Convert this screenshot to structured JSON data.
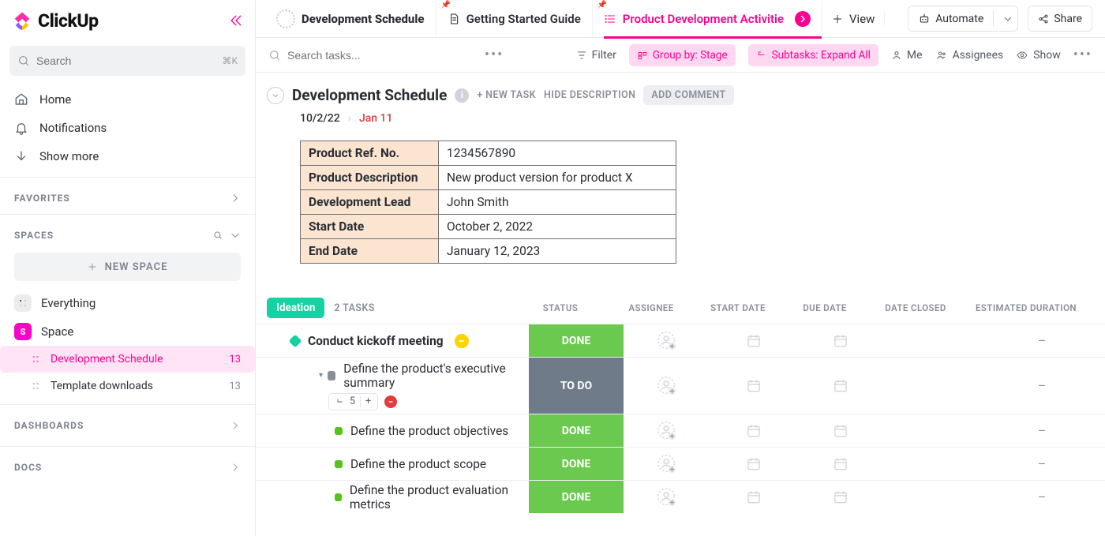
{
  "brand": {
    "name": "ClickUp"
  },
  "sidebar": {
    "search_placeholder": "Search",
    "search_kbd": "⌘K",
    "nav": [
      "Home",
      "Notifications",
      "Show more"
    ],
    "favorites_label": "FAVORITES",
    "spaces_label": "SPACES",
    "new_space_label": "NEW SPACE",
    "everything_label": "Everything",
    "space_label": "Space",
    "space_initial": "S",
    "children": [
      {
        "label": "Development Schedule",
        "count": "13",
        "active": true
      },
      {
        "label": "Template downloads",
        "count": "13",
        "active": false
      }
    ],
    "dashboards_label": "DASHBOARDS",
    "docs_label": "DOCS"
  },
  "tabs": {
    "items": [
      {
        "label": "Development Schedule"
      },
      {
        "label": "Getting Started Guide"
      },
      {
        "label": "Product Development Activitie"
      }
    ],
    "add_view": "View",
    "automate": "Automate",
    "share": "Share"
  },
  "toolbar": {
    "search_placeholder": "Search tasks...",
    "filter": "Filter",
    "group_by": "Group by: Stage",
    "subtasks": "Subtasks: Expand All",
    "me": "Me",
    "assignees": "Assignees",
    "show": "Show"
  },
  "list_header": {
    "title": "Development Schedule",
    "new_task": "+ NEW TASK",
    "hide_desc": "HIDE DESCRIPTION",
    "add_comment": "ADD COMMENT",
    "date_start": "10/2/22",
    "date_due": "Jan 11"
  },
  "info_table": [
    [
      "Product Ref. No.",
      "1234567890"
    ],
    [
      "Product Description",
      "New product version for product X"
    ],
    [
      "Development Lead",
      "John Smith"
    ],
    [
      "Start Date",
      "October 2, 2022"
    ],
    [
      "End Date",
      "January 12, 2023"
    ]
  ],
  "group": {
    "stage": "Ideation",
    "count_label": "2 TASKS",
    "columns": [
      "STATUS",
      "ASSIGNEE",
      "START DATE",
      "DUE DATE",
      "DATE CLOSED",
      "ESTIMATED DURATION"
    ]
  },
  "tasks": [
    {
      "level": 0,
      "title": "Conduct kickoff meeting",
      "status": "DONE",
      "status_kind": "done",
      "milestone": true,
      "badge": "yellow",
      "duration": "–"
    },
    {
      "level": 0,
      "title": "Define the product's executive summary",
      "status": "TO DO",
      "status_kind": "todo",
      "sub_count": "5",
      "red_badge": true,
      "expanded": true,
      "duration": "–"
    },
    {
      "level": 1,
      "title": "Define the product objectives",
      "status": "DONE",
      "status_kind": "done",
      "duration": "–"
    },
    {
      "level": 1,
      "title": "Define the product scope",
      "status": "DONE",
      "status_kind": "done",
      "duration": "–"
    },
    {
      "level": 1,
      "title": "Define the product evaluation metrics",
      "status": "DONE",
      "status_kind": "done",
      "duration": "–"
    }
  ]
}
